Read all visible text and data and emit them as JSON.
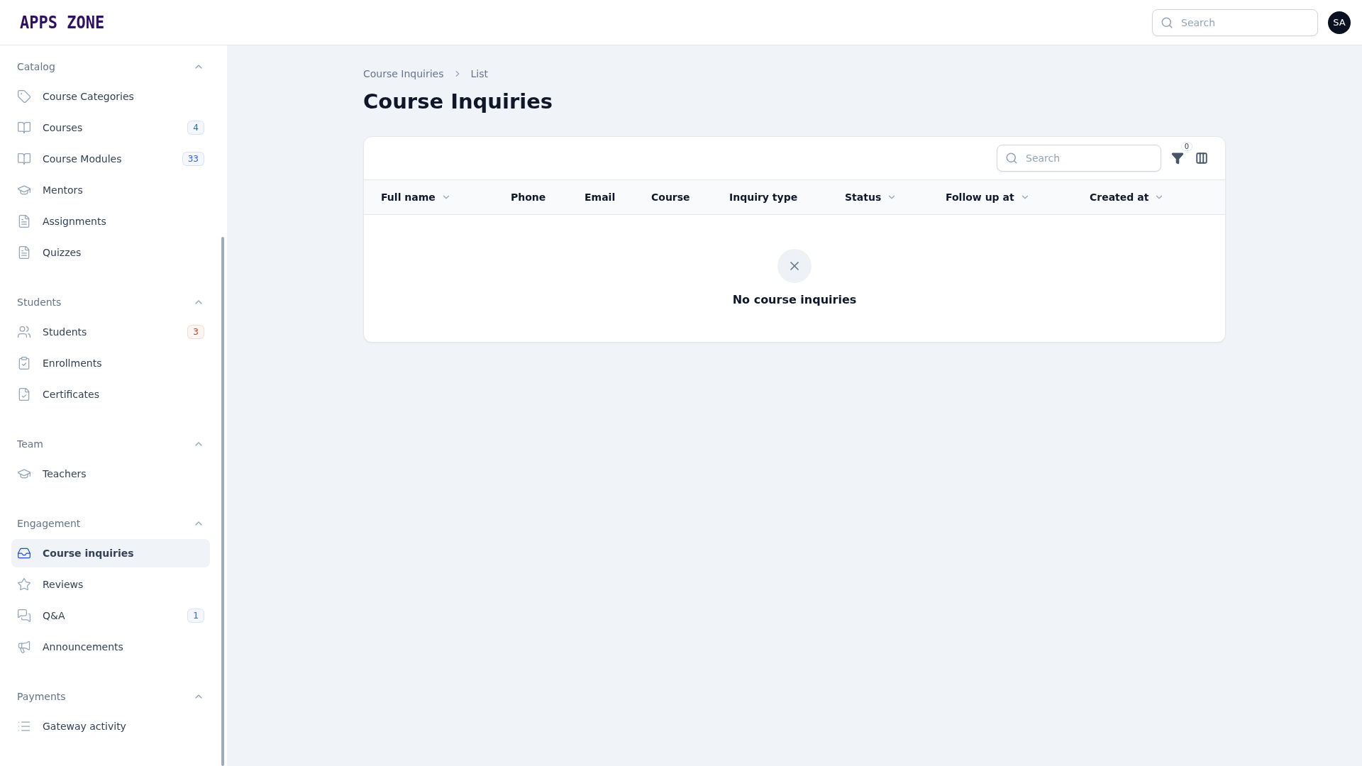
{
  "logo": "APPS ZONE",
  "header_search": {
    "placeholder": "Search"
  },
  "avatar": "SA",
  "sidebar": [
    {
      "title": "Catalog",
      "expanded": true,
      "items": [
        {
          "label": "Course Categories",
          "selected": false
        },
        {
          "label": "Courses",
          "selected": false,
          "badge": {
            "text": "4",
            "color": "#2563eb"
          }
        },
        {
          "label": "Course Modules",
          "selected": false,
          "badge": {
            "text": "33",
            "color": "#2563eb"
          }
        },
        {
          "label": "Mentors",
          "selected": false
        },
        {
          "label": "Assignments",
          "selected": false
        },
        {
          "label": "Quizzes",
          "selected": false
        }
      ]
    },
    {
      "title": "Students",
      "expanded": true,
      "items": [
        {
          "label": "Students",
          "selected": false,
          "badge": {
            "text": "3",
            "color": "#c2410c"
          }
        },
        {
          "label": "Enrollments",
          "selected": false
        },
        {
          "label": "Certificates",
          "selected": false
        }
      ]
    },
    {
      "title": "Team",
      "expanded": true,
      "items": [
        {
          "label": "Teachers",
          "selected": false
        }
      ]
    },
    {
      "title": "Engagement",
      "expanded": true,
      "items": [
        {
          "label": "Course inquiries",
          "selected": true
        },
        {
          "label": "Reviews",
          "selected": false
        },
        {
          "label": "Q&A",
          "selected": false,
          "badge": {
            "text": "1",
            "color": "#2563eb"
          }
        },
        {
          "label": "Announcements",
          "selected": false
        }
      ]
    },
    {
      "title": "Payments",
      "expanded": true,
      "items": [
        {
          "label": "Gateway activity",
          "selected": false
        }
      ]
    }
  ],
  "breadcrumbs": [
    "Course Inquiries",
    "List"
  ],
  "page_title": "Course Inquiries",
  "table": {
    "search": {
      "placeholder": "Search"
    },
    "filter_count": "0",
    "columns": [
      {
        "label": "Full name",
        "sortable": true
      },
      {
        "label": "Phone",
        "sortable": false
      },
      {
        "label": "Email",
        "sortable": false
      },
      {
        "label": "Course",
        "sortable": false
      },
      {
        "label": "Inquiry type",
        "sortable": false
      },
      {
        "label": "Status",
        "sortable": true
      },
      {
        "label": "Follow up at",
        "sortable": true
      },
      {
        "label": "Created at",
        "sortable": true
      }
    ],
    "empty_message": "No course inquiries"
  }
}
